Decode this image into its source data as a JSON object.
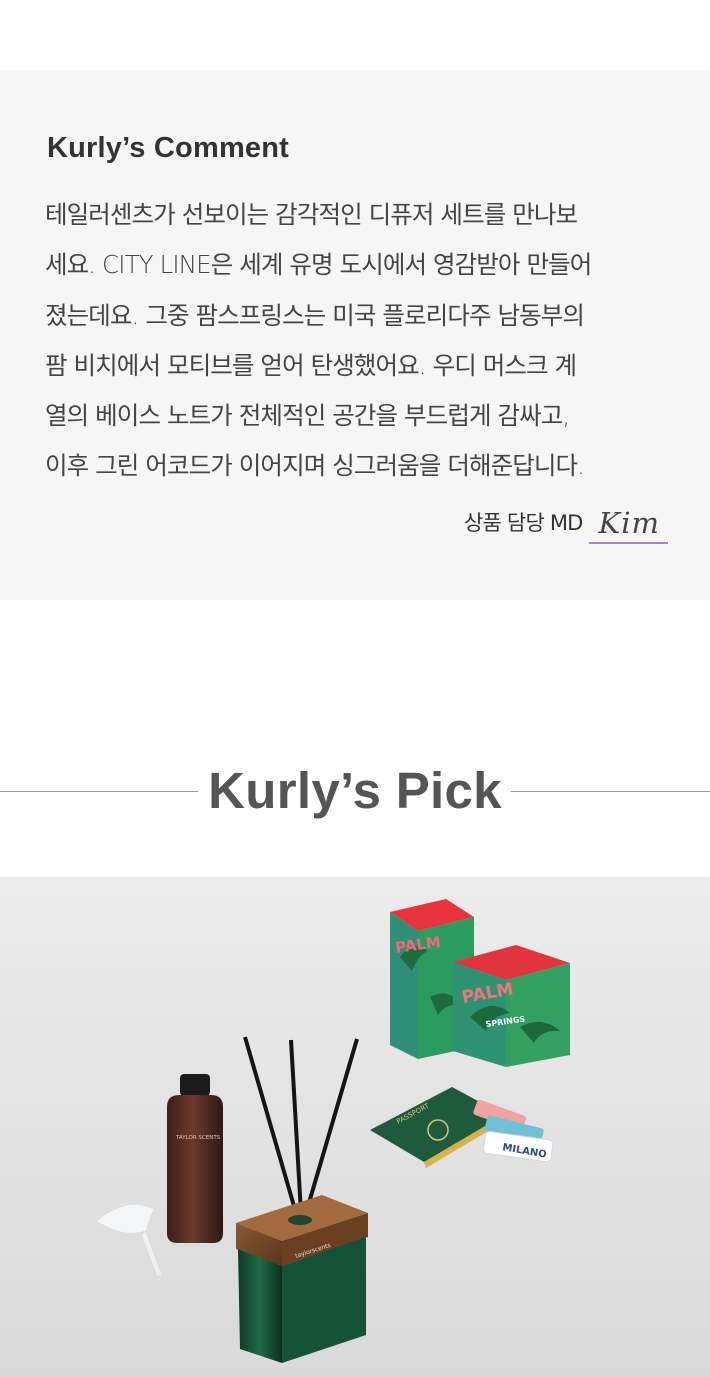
{
  "comment": {
    "title": "Kurly’s Comment",
    "lines": [
      "테일러센츠가 선보이는 감각적인 디퓨저 세트를 만나보",
      "세요. CITY LINE은 세계 유명 도시에서 영감받아 만들어",
      "졌는데요. 그중 팜스프링스는 미국 플로리다주 남동부의",
      "팜 비치에서 모티브를 얻어 탄생했어요. 우디 머스크 계",
      "열의 베이스 노트가 전체적인 공간을 부드럽게 감싸고,",
      "이후 그린 어코드가 이어지며 싱그러움을 더해준답니다."
    ],
    "signature_label": "상품 담당 MD",
    "signature_name": "Kim"
  },
  "pick": {
    "title": "Kurly’s Pick"
  },
  "photo": {
    "box_front_text": "PALM",
    "box_back_text": "PALM",
    "box_sub_text": "SPRINGS",
    "passport_text": "PASSPORT",
    "ticket_text": "MILANO",
    "bottle_label": "TAYLOR SCENTS",
    "diffuser_label": "taylorscents"
  }
}
